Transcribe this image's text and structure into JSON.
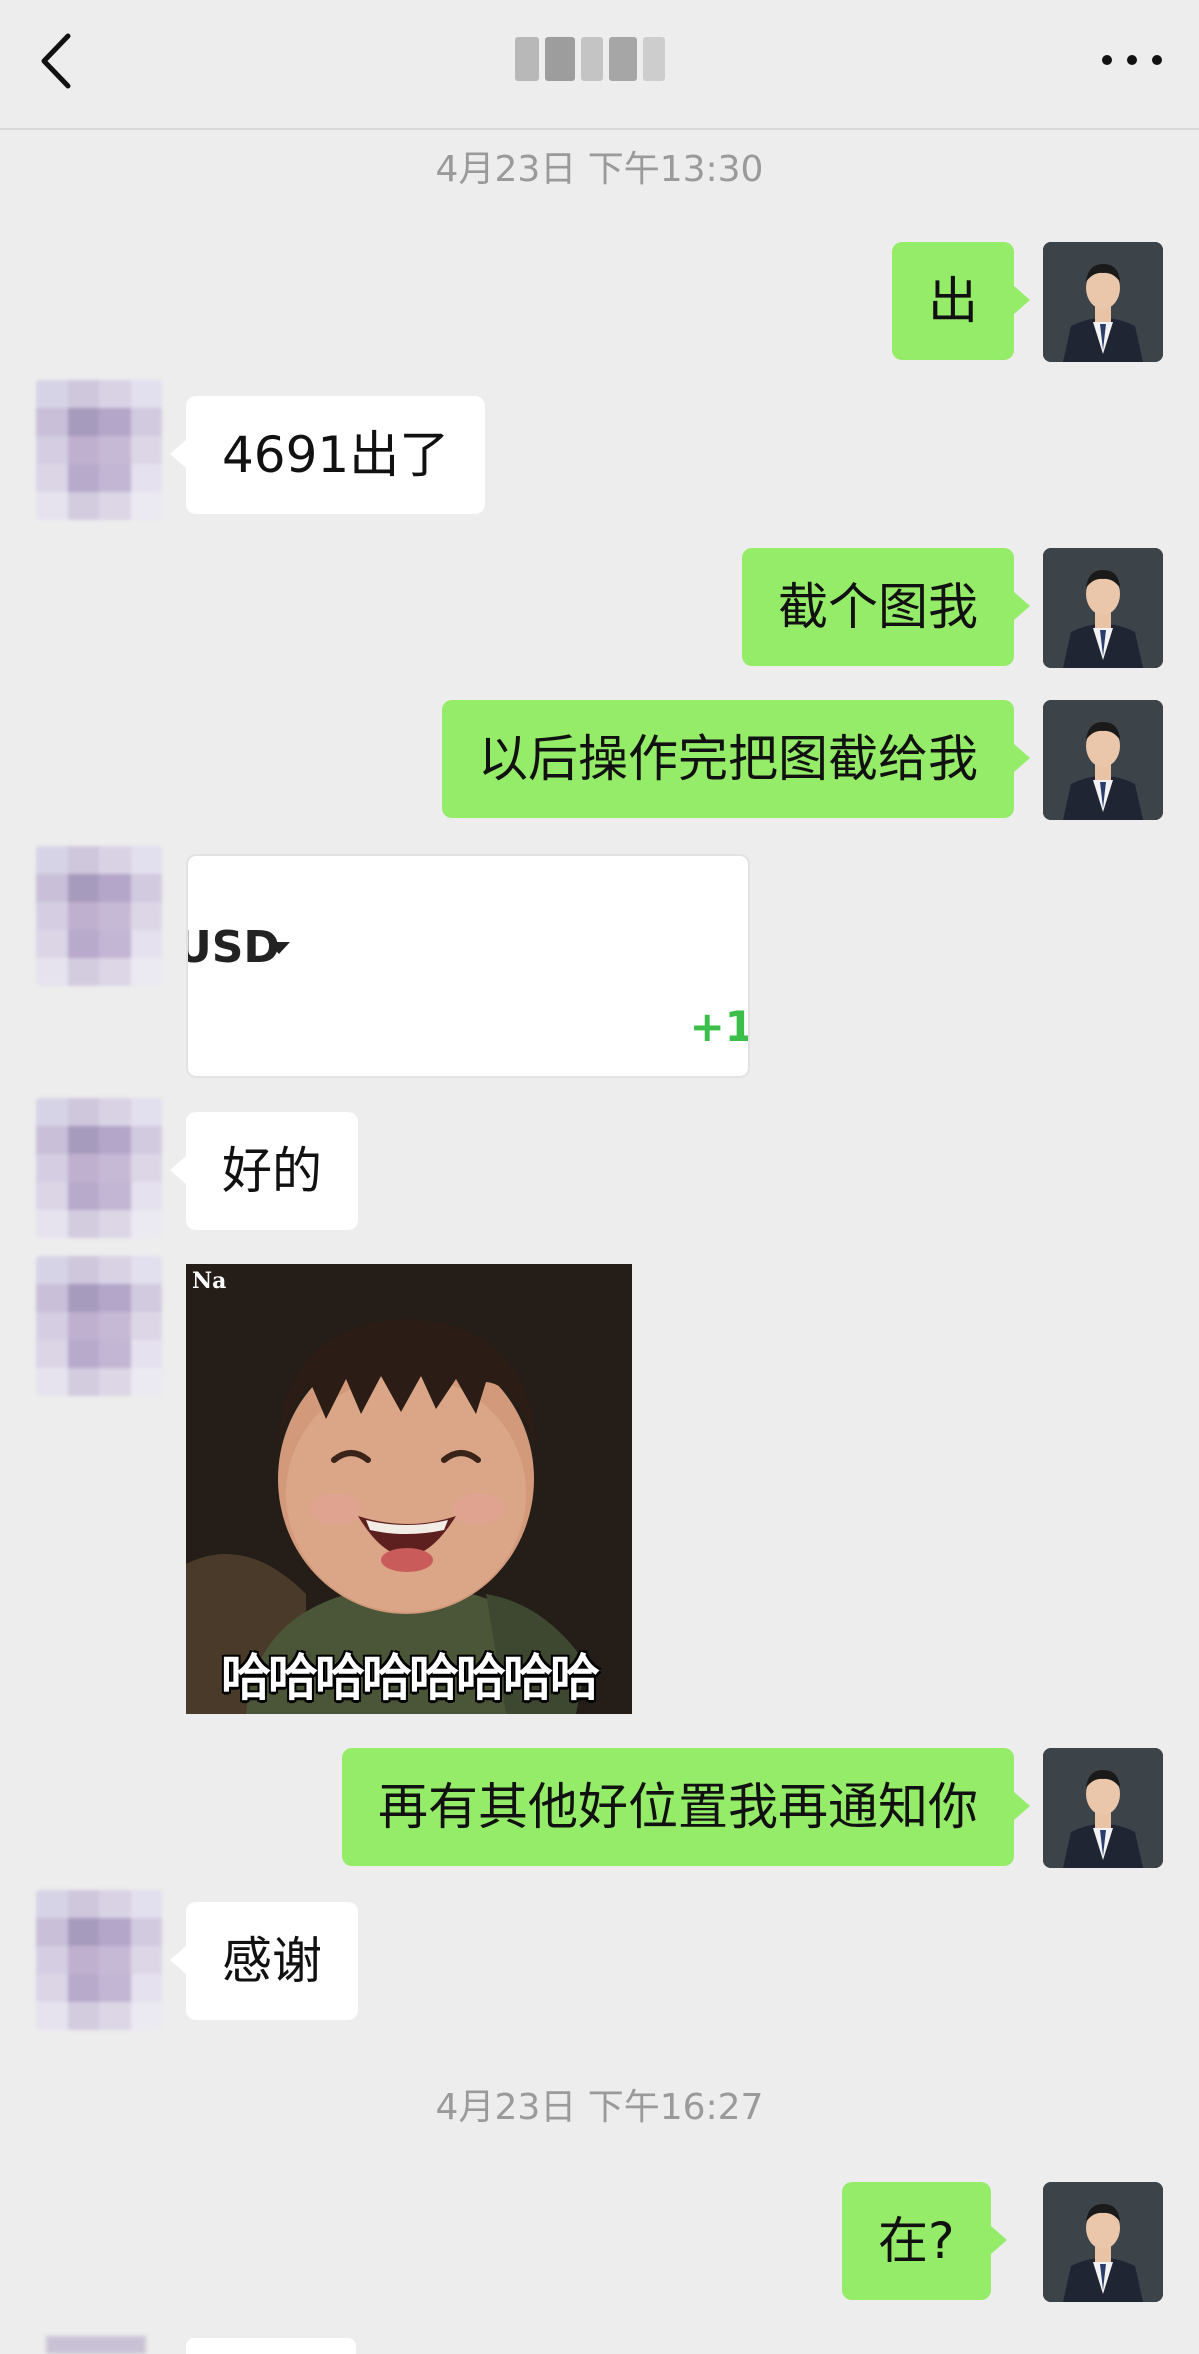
{
  "header": {
    "title": "",
    "back_icon": "chevron-left-icon",
    "more_icon": "more-horizontal-icon"
  },
  "timestamps": [
    "4月23日 下午13:30",
    "4月23日 下午16:27"
  ],
  "messages": [
    {
      "sender": "me",
      "text": "出"
    },
    {
      "sender": "other",
      "text": "4691出了"
    },
    {
      "sender": "me",
      "text": "截个图我"
    },
    {
      "sender": "me",
      "text": "以后操作完把图截给我"
    },
    {
      "sender": "other",
      "type": "card",
      "currency": "USD",
      "delta": "+1"
    },
    {
      "sender": "other",
      "text": "好的"
    },
    {
      "sender": "other",
      "type": "sticker",
      "tag": "Na",
      "caption": "哈哈哈哈哈哈哈哈"
    },
    {
      "sender": "me",
      "text": "再有其他好位置我再通知你"
    },
    {
      "sender": "other",
      "text": "感谢"
    },
    {
      "sender": "me",
      "text": "在?"
    }
  ],
  "colors": {
    "background": "#ededed",
    "my_bubble": "#95ec69",
    "other_bubble": "#ffffff",
    "timestamp": "#9a9a9a",
    "positive": "#3bbf4a"
  }
}
